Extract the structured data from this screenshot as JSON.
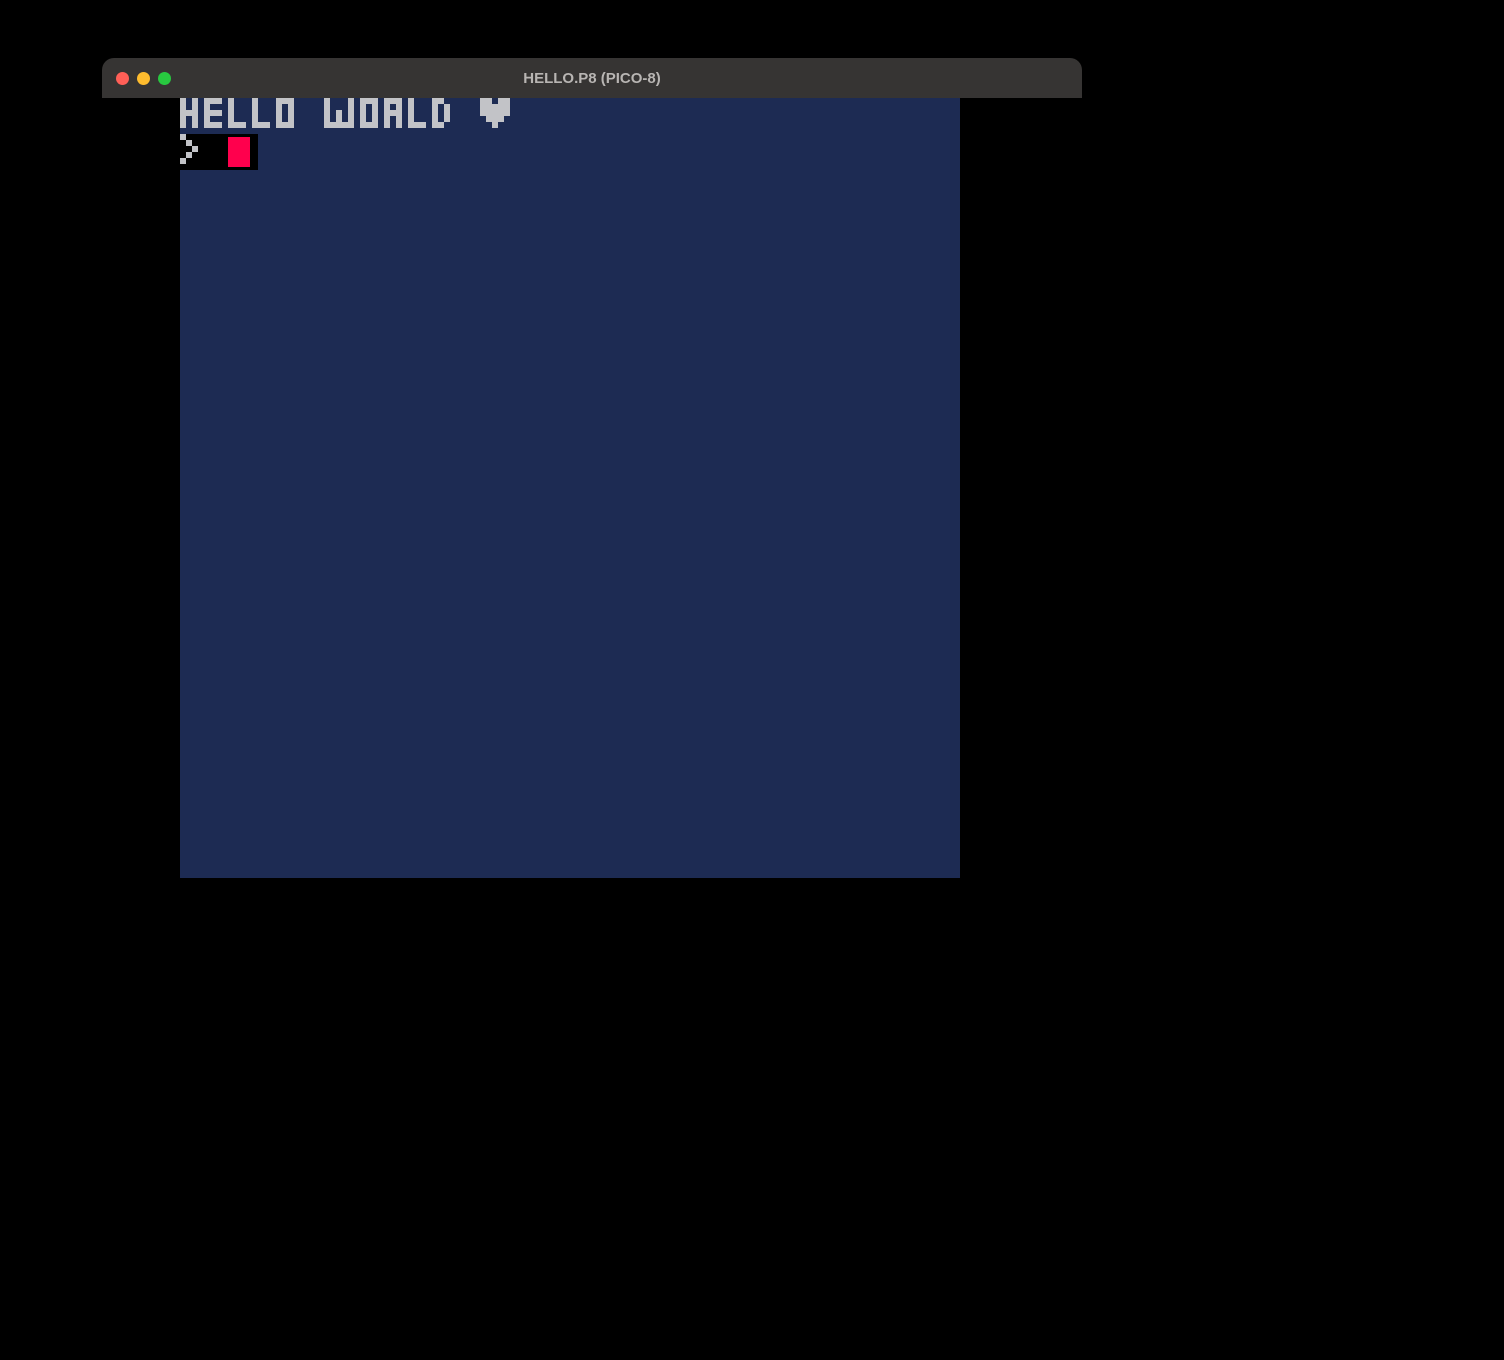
{
  "window": {
    "title": "HELLO.P8 (PICO-8)"
  },
  "console": {
    "output_line": "HELLO WORLD",
    "glyph": "heart",
    "prompt": ">",
    "cursor_color": "#ff004d",
    "bg_color": "#1d2b53",
    "text_color": "#c2c3c7"
  }
}
